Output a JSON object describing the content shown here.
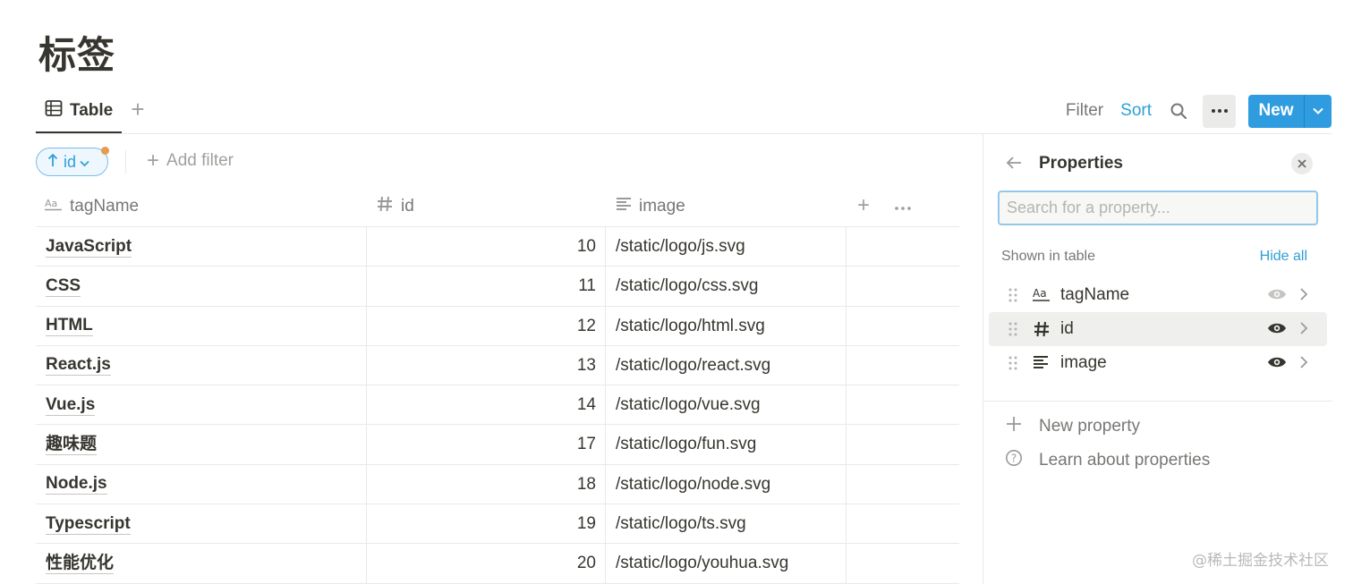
{
  "page": {
    "title": "标签"
  },
  "views": {
    "tabs": [
      {
        "label": "Table",
        "icon": "table-icon"
      }
    ],
    "add_view_icon": "plus-icon"
  },
  "toolbar": {
    "filter_label": "Filter",
    "sort_label": "Sort",
    "new_label": "New"
  },
  "filter_bar": {
    "sort_chip_label": "id",
    "add_filter_label": "Add filter"
  },
  "table": {
    "columns": [
      {
        "label": "tagName",
        "icon": "text-type-icon"
      },
      {
        "label": "id",
        "icon": "number-type-icon"
      },
      {
        "label": "image",
        "icon": "lines-type-icon"
      }
    ],
    "rows": [
      {
        "tagName": "JavaScript",
        "id": "10",
        "image": "/static/logo/js.svg"
      },
      {
        "tagName": "CSS",
        "id": "11",
        "image": "/static/logo/css.svg"
      },
      {
        "tagName": "HTML",
        "id": "12",
        "image": "/static/logo/html.svg"
      },
      {
        "tagName": "React.js",
        "id": "13",
        "image": "/static/logo/react.svg"
      },
      {
        "tagName": "Vue.js",
        "id": "14",
        "image": "/static/logo/vue.svg"
      },
      {
        "tagName": "趣味题",
        "id": "17",
        "image": "/static/logo/fun.svg"
      },
      {
        "tagName": "Node.js",
        "id": "18",
        "image": "/static/logo/node.svg"
      },
      {
        "tagName": "Typescript",
        "id": "19",
        "image": "/static/logo/ts.svg"
      },
      {
        "tagName": "性能优化",
        "id": "20",
        "image": "/static/logo/youhua.svg"
      }
    ]
  },
  "properties_panel": {
    "title": "Properties",
    "search_placeholder": "Search for a property...",
    "section_label": "Shown in table",
    "hide_all_label": "Hide all",
    "items": [
      {
        "name": "tagName",
        "icon": "text-type-icon",
        "visible": true,
        "active": false
      },
      {
        "name": "id",
        "icon": "number-type-icon",
        "visible": true,
        "active": true
      },
      {
        "name": "image",
        "icon": "lines-type-icon",
        "visible": true,
        "active": false
      }
    ],
    "new_property_label": "New property",
    "learn_label": "Learn about properties"
  },
  "watermark": "@稀土掘金技术社区",
  "colors": {
    "accent": "#2e9fd7",
    "new_button": "#2f9ce0",
    "text": "#37352f",
    "muted": "#787774"
  }
}
